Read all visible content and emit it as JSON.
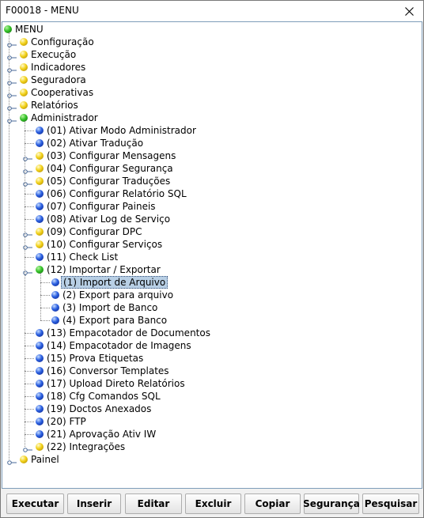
{
  "window": {
    "title": "F00018 - MENU"
  },
  "tree": {
    "root": "MENU",
    "top_items": [
      "Configuração",
      "Execução",
      "Indicadores",
      "Seguradora",
      "Cooperativas",
      "Relatórios",
      "Administrador"
    ],
    "admin_items": [
      "(01) Ativar Modo Administrador",
      "(02) Ativar Tradução",
      "(03) Configurar Mensagens",
      "(04) Configurar Segurança",
      "(05) Configurar Traduções",
      "(06) Configurar Relatório SQL",
      "(07) Configurar Paineis",
      "(08) Ativar Log de Serviço",
      "(09) Configurar DPC",
      "(10) Configurar Serviços",
      "(11) Check List",
      "(12) Importar / Exportar"
    ],
    "import_export_items": [
      "(1) Import de Arquivo",
      "(2) Export para arquivo",
      "(3) Import de Banco",
      "(4) Export para Banco"
    ],
    "admin_items_after": [
      "(13) Empacotador de Documentos",
      "(14) Empacotador de Imagens",
      "(15) Prova Etiquetas",
      "(16) Conversor Templates",
      "(17) Upload Direto Relatórios",
      "(18) Cfg Comandos SQL",
      "(19) Doctos Anexados",
      "(20) FTP",
      "(21) Aprovação Ativ IW",
      "(22) Integrações"
    ],
    "last_item": "Painel"
  },
  "buttons": {
    "executar": "Executar",
    "inserir": "Inserir",
    "editar": "Editar",
    "excluir": "Excluir",
    "copiar": "Copiar",
    "seguranca": "Segurança",
    "pesquisar": "Pesquisar"
  },
  "colors": {
    "selection": "#b8cfe5",
    "bullet_green": "#36c22a",
    "bullet_yellow": "#f2d21a",
    "bullet_blue": "#2a5fe0"
  }
}
